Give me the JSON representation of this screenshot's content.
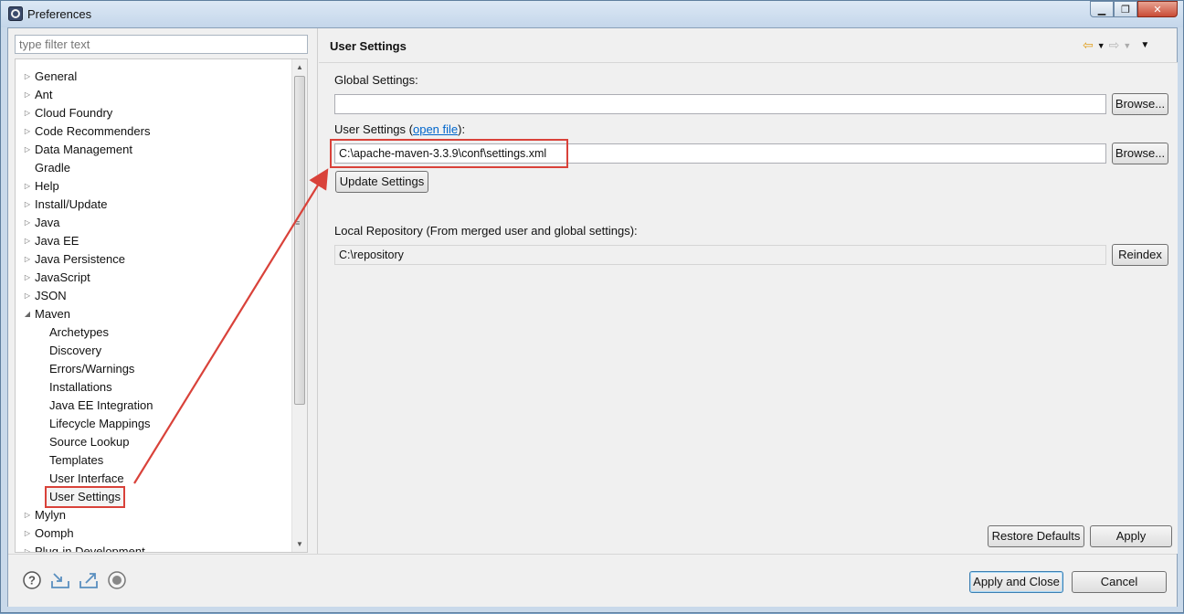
{
  "window": {
    "title": "Preferences",
    "minimize_label": "▁",
    "restore_label": "❐",
    "close_label": "✕"
  },
  "filter": {
    "placeholder": "type filter text"
  },
  "tree": {
    "items": [
      {
        "label": "General",
        "level": 0,
        "expander": "collapsed"
      },
      {
        "label": "Ant",
        "level": 0,
        "expander": "collapsed"
      },
      {
        "label": "Cloud Foundry",
        "level": 0,
        "expander": "collapsed"
      },
      {
        "label": "Code Recommenders",
        "level": 0,
        "expander": "collapsed"
      },
      {
        "label": "Data Management",
        "level": 0,
        "expander": "collapsed"
      },
      {
        "label": "Gradle",
        "level": 0,
        "expander": "none"
      },
      {
        "label": "Help",
        "level": 0,
        "expander": "collapsed"
      },
      {
        "label": "Install/Update",
        "level": 0,
        "expander": "collapsed"
      },
      {
        "label": "Java",
        "level": 0,
        "expander": "collapsed"
      },
      {
        "label": "Java EE",
        "level": 0,
        "expander": "collapsed"
      },
      {
        "label": "Java Persistence",
        "level": 0,
        "expander": "collapsed"
      },
      {
        "label": "JavaScript",
        "level": 0,
        "expander": "collapsed"
      },
      {
        "label": "JSON",
        "level": 0,
        "expander": "collapsed"
      },
      {
        "label": "Maven",
        "level": 0,
        "expander": "expanded"
      },
      {
        "label": "Archetypes",
        "level": 1,
        "expander": "none"
      },
      {
        "label": "Discovery",
        "level": 1,
        "expander": "none"
      },
      {
        "label": "Errors/Warnings",
        "level": 1,
        "expander": "none"
      },
      {
        "label": "Installations",
        "level": 1,
        "expander": "none"
      },
      {
        "label": "Java EE Integration",
        "level": 1,
        "expander": "none"
      },
      {
        "label": "Lifecycle Mappings",
        "level": 1,
        "expander": "none"
      },
      {
        "label": "Source Lookup",
        "level": 1,
        "expander": "none"
      },
      {
        "label": "Templates",
        "level": 1,
        "expander": "none"
      },
      {
        "label": "User Interface",
        "level": 1,
        "expander": "none"
      },
      {
        "label": "User Settings",
        "level": 1,
        "expander": "none",
        "selected": true
      },
      {
        "label": "Mylyn",
        "level": 0,
        "expander": "collapsed"
      },
      {
        "label": "Oomph",
        "level": 0,
        "expander": "collapsed"
      },
      {
        "label": "Plug-in Development",
        "level": 0,
        "expander": "collapsed"
      }
    ]
  },
  "page": {
    "title": "User Settings",
    "global_settings_label": "Global Settings:",
    "global_settings_value": "",
    "global_browse_label": "Browse...",
    "user_settings_label_pre": "User Settings (",
    "user_settings_link": "open file",
    "user_settings_label_post": "):",
    "user_settings_value": "C:\\apache-maven-3.3.9\\conf\\settings.xml",
    "user_browse_label": "Browse...",
    "update_settings_label": "Update Settings",
    "local_repo_label": "Local Repository (From merged user and global settings):",
    "local_repo_value": "C:\\repository",
    "reindex_label": "Reindex",
    "restore_defaults_label": "Restore Defaults",
    "apply_label": "Apply"
  },
  "footer": {
    "apply_close_label": "Apply and Close",
    "cancel_label": "Cancel",
    "icons": [
      "help-icon",
      "import-icon",
      "export-icon",
      "record-icon"
    ]
  },
  "colors": {
    "highlight": "#d9423a",
    "link": "#0066cc",
    "nav_back": "#e8a317"
  }
}
